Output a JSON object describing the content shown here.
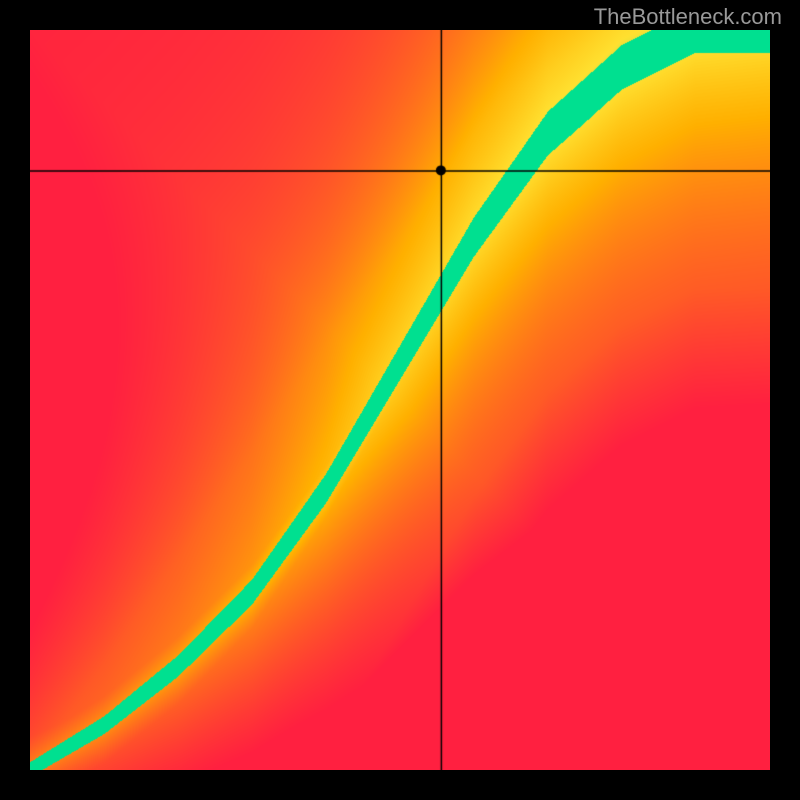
{
  "watermark": "TheBottleneck.com",
  "chart_data": {
    "type": "heatmap",
    "title": "",
    "xlabel": "",
    "ylabel": "",
    "xlim": [
      0,
      1
    ],
    "ylim": [
      0,
      1
    ],
    "crosshair": {
      "x": 0.556,
      "y": 0.81
    },
    "marker": {
      "x": 0.556,
      "y": 0.81
    },
    "color_scale": {
      "description": "Red (worst) → Yellow/Orange → Green (optimal)",
      "stops": [
        {
          "value": 0.0,
          "color": "#ff2040"
        },
        {
          "value": 0.5,
          "color": "#ffb000"
        },
        {
          "value": 0.75,
          "color": "#ffe030"
        },
        {
          "value": 1.0,
          "color": "#00e090"
        }
      ]
    },
    "optimal_curve": {
      "description": "Green band where components are balanced",
      "points": [
        {
          "x": 0.0,
          "y": 0.0
        },
        {
          "x": 0.1,
          "y": 0.06
        },
        {
          "x": 0.2,
          "y": 0.14
        },
        {
          "x": 0.3,
          "y": 0.24
        },
        {
          "x": 0.4,
          "y": 0.38
        },
        {
          "x": 0.5,
          "y": 0.55
        },
        {
          "x": 0.6,
          "y": 0.72
        },
        {
          "x": 0.7,
          "y": 0.86
        },
        {
          "x": 0.8,
          "y": 0.95
        },
        {
          "x": 0.9,
          "y": 1.0
        }
      ],
      "band_width_fraction_top": 0.06,
      "band_width_fraction_bottom": 0.02
    }
  }
}
